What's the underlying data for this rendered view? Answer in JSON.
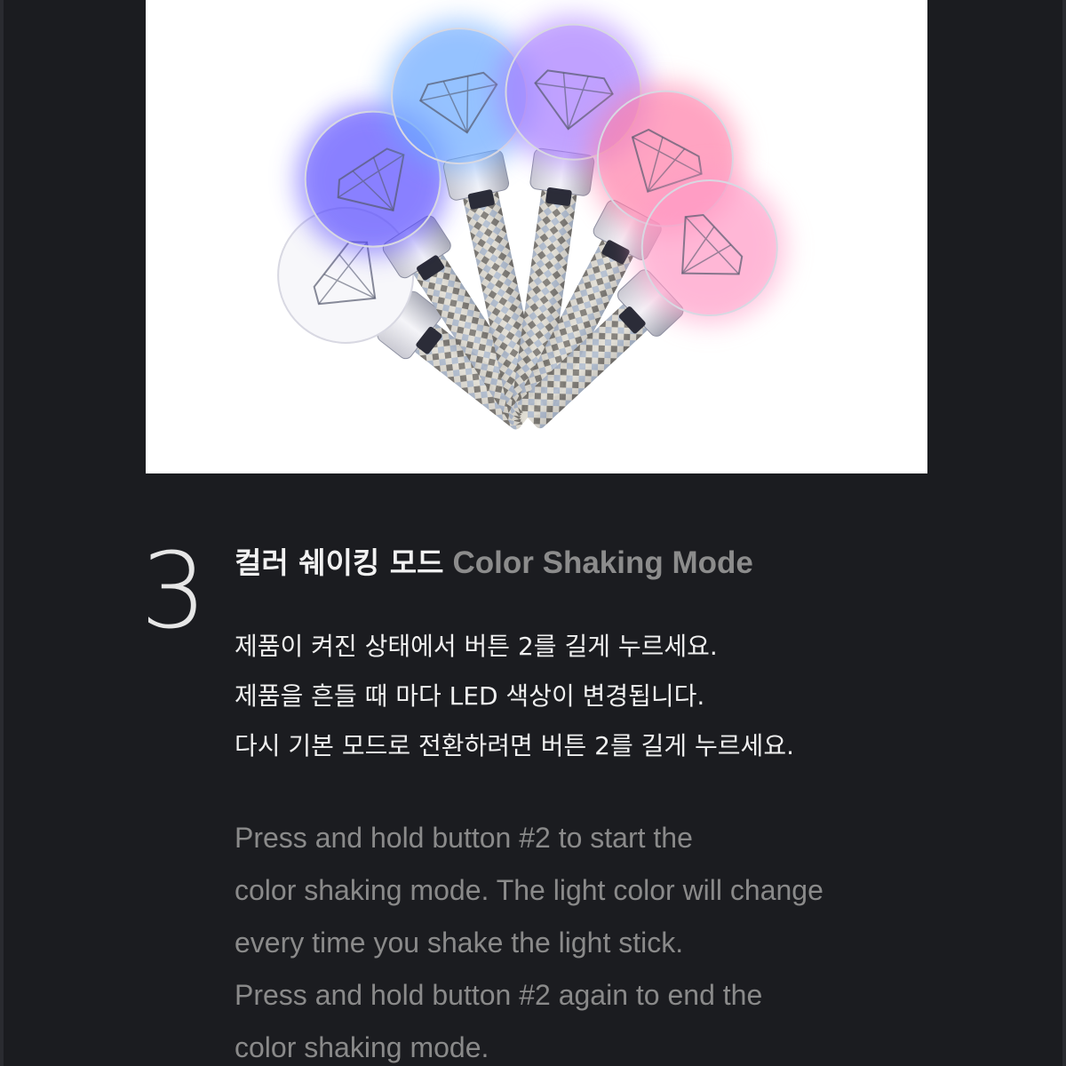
{
  "step": {
    "number": "3",
    "title_ko": "컬러 쉐이킹 모드",
    "title_en": "Color Shaking Mode"
  },
  "description_ko": [
    "제품이 켜진 상태에서 버튼 2를 길게 누르세요.",
    "제품을 흔들 때 마다 LED 색상이 변경됩니다.",
    "다시 기본 모드로 전환하려면 버튼 2를 길게 누르세요."
  ],
  "description_en": [
    "Press and hold button #2 to start the",
    "color shaking mode. The light color will change",
    "every time you shake the light stick.",
    "Press and hold button #2 again to end the",
    "color shaking mode."
  ],
  "hero_image": {
    "subject": "light-sticks-fan",
    "glow_colors": [
      "#ffffff",
      "#5a4cff",
      "#6aa8ff",
      "#a77cff",
      "#ff7fa8",
      "#ff9ac6"
    ]
  }
}
